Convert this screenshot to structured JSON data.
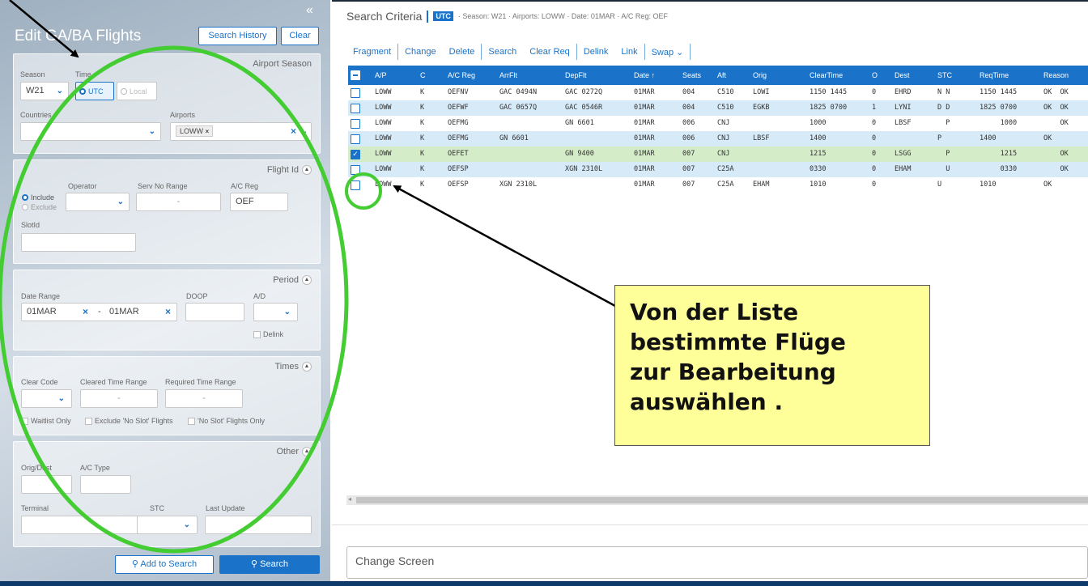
{
  "left": {
    "title": "Edit GA/BA Flights",
    "search_history": "Search History",
    "clear": "Clear",
    "airport_season": {
      "title": "Airport Season",
      "season_label": "Season",
      "season_value": "W21",
      "time_label": "Time",
      "utc": "UTC",
      "local": "Local",
      "countries_label": "Countries",
      "airports_label": "Airports",
      "airport_chip": "LOWW"
    },
    "flight_id": {
      "title": "Flight Id",
      "include": "Include",
      "exclude": "Exclude",
      "operator_label": "Operator",
      "serv_no_label": "Serv No Range",
      "serv_no_sep": "-",
      "ac_reg_label": "A/C Reg",
      "ac_reg_value": "OEF",
      "slotid_label": "SlotId"
    },
    "period": {
      "title": "Period",
      "date_range_label": "Date Range",
      "date_from": "01MAR",
      "date_sep": "-",
      "date_to": "01MAR",
      "doop_label": "DOOP",
      "ad_label": "A/D",
      "delink": "Delink"
    },
    "times": {
      "title": "Times",
      "clear_code_label": "Clear Code",
      "cleared_range_label": "Cleared Time Range",
      "required_range_label": "Required Time Range",
      "range_sep": "-",
      "waitlist": "Waitlist Only",
      "exclude_no_slot": "Exclude 'No Slot' Flights",
      "no_slot_only": "'No Slot' Flights Only"
    },
    "other": {
      "title": "Other",
      "orig_dest_label": "Orig/Dest",
      "ac_type_label": "A/C Type",
      "terminal_label": "Terminal",
      "stc_label": "STC",
      "last_update_label": "Last Update"
    },
    "add_to_search": "Add to Search",
    "search": "Search"
  },
  "criteria": {
    "title": "Search Criteria",
    "utc_badge": "UTC",
    "summary": "· Season: W21 · Airports: LOWW · Date: 01MAR · A/C Reg: OEF"
  },
  "toolbar": {
    "fragment": "Fragment",
    "change": "Change",
    "delete": "Delete",
    "search": "Search",
    "clear_req": "Clear Req",
    "delink": "Delink",
    "link": "Link",
    "swap": "Swap ⌄"
  },
  "grid": {
    "columns": [
      "A/P",
      "C",
      "A/C Reg",
      "ArrFlt",
      "DepFlt",
      "Date ↑",
      "Seats",
      "Aft",
      "Orig",
      "ClearTime",
      "O",
      "Dest",
      "STC",
      "ReqTime",
      "Reason"
    ],
    "rows": [
      {
        "checked": false,
        "ap": "LOWW",
        "c": "K",
        "reg": "OEFNV",
        "arr": "GAC 0494N",
        "dep": "GAC 0272Q",
        "date": "01MAR",
        "seats": "004",
        "aft": "C510",
        "orig": "LOWI",
        "clear": "1150 1445",
        "o": "0",
        "dest": "EHRD",
        "stc": "N N",
        "req": "1150 1445",
        "reason": "OK  OK"
      },
      {
        "checked": false,
        "ap": "LOWW",
        "c": "K",
        "reg": "OEFWF",
        "arr": "GAC 0657Q",
        "dep": "GAC 0546R",
        "date": "01MAR",
        "seats": "004",
        "aft": "C510",
        "orig": "EGKB",
        "clear": "1825 0700",
        "o": "1",
        "dest": "LYNI",
        "stc": "D D",
        "req": "1825 0700",
        "reason": "OK  OK"
      },
      {
        "checked": false,
        "ap": "LOWW",
        "c": "K",
        "reg": "OEFMG",
        "arr": "",
        "dep": "GN 6601",
        "date": "01MAR",
        "seats": "006",
        "aft": "CNJ",
        "orig": "",
        "clear": "1000",
        "o": "0",
        "dest": "LBSF",
        "stc": "  P",
        "req": "     1000",
        "reason": "    OK"
      },
      {
        "checked": false,
        "ap": "LOWW",
        "c": "K",
        "reg": "OEFMG",
        "arr": "GN 6601",
        "dep": "",
        "date": "01MAR",
        "seats": "006",
        "aft": "CNJ",
        "orig": "LBSF",
        "clear": "1400",
        "o": "0",
        "dest": "",
        "stc": "P",
        "req": "1400",
        "reason": "OK"
      },
      {
        "checked": true,
        "ap": "LOWW",
        "c": "K",
        "reg": "OEFET",
        "arr": "",
        "dep": "GN 9400",
        "date": "01MAR",
        "seats": "007",
        "aft": "CNJ",
        "orig": "",
        "clear": "1215",
        "o": "0",
        "dest": "LSGG",
        "stc": "  P",
        "req": "     1215",
        "reason": "    OK"
      },
      {
        "checked": false,
        "ap": "LOWW",
        "c": "K",
        "reg": "OEFSP",
        "arr": "",
        "dep": "XGN 2310L",
        "date": "01MAR",
        "seats": "007",
        "aft": "C25A",
        "orig": "",
        "clear": "0330",
        "o": "0",
        "dest": "EHAM",
        "stc": "  U",
        "req": "     0330",
        "reason": "    OK"
      },
      {
        "checked": false,
        "ap": "LOWW",
        "c": "K",
        "reg": "OEFSP",
        "arr": "XGN 2310L",
        "dep": "",
        "date": "01MAR",
        "seats": "007",
        "aft": "C25A",
        "orig": "EHAM",
        "clear": "1010",
        "o": "0",
        "dest": "",
        "stc": "U",
        "req": "1010",
        "reason": "OK"
      }
    ]
  },
  "change_screen": "Change Screen",
  "callout": {
    "line1": "Von der Liste",
    "line2": "bestimmte Flüge",
    "line3": "zur Bearbeitung",
    "line4": "auswählen ."
  },
  "colors": {
    "accent": "#1a73c9",
    "annotation_green": "#44cc33",
    "callout_bg": "#ffff99"
  }
}
